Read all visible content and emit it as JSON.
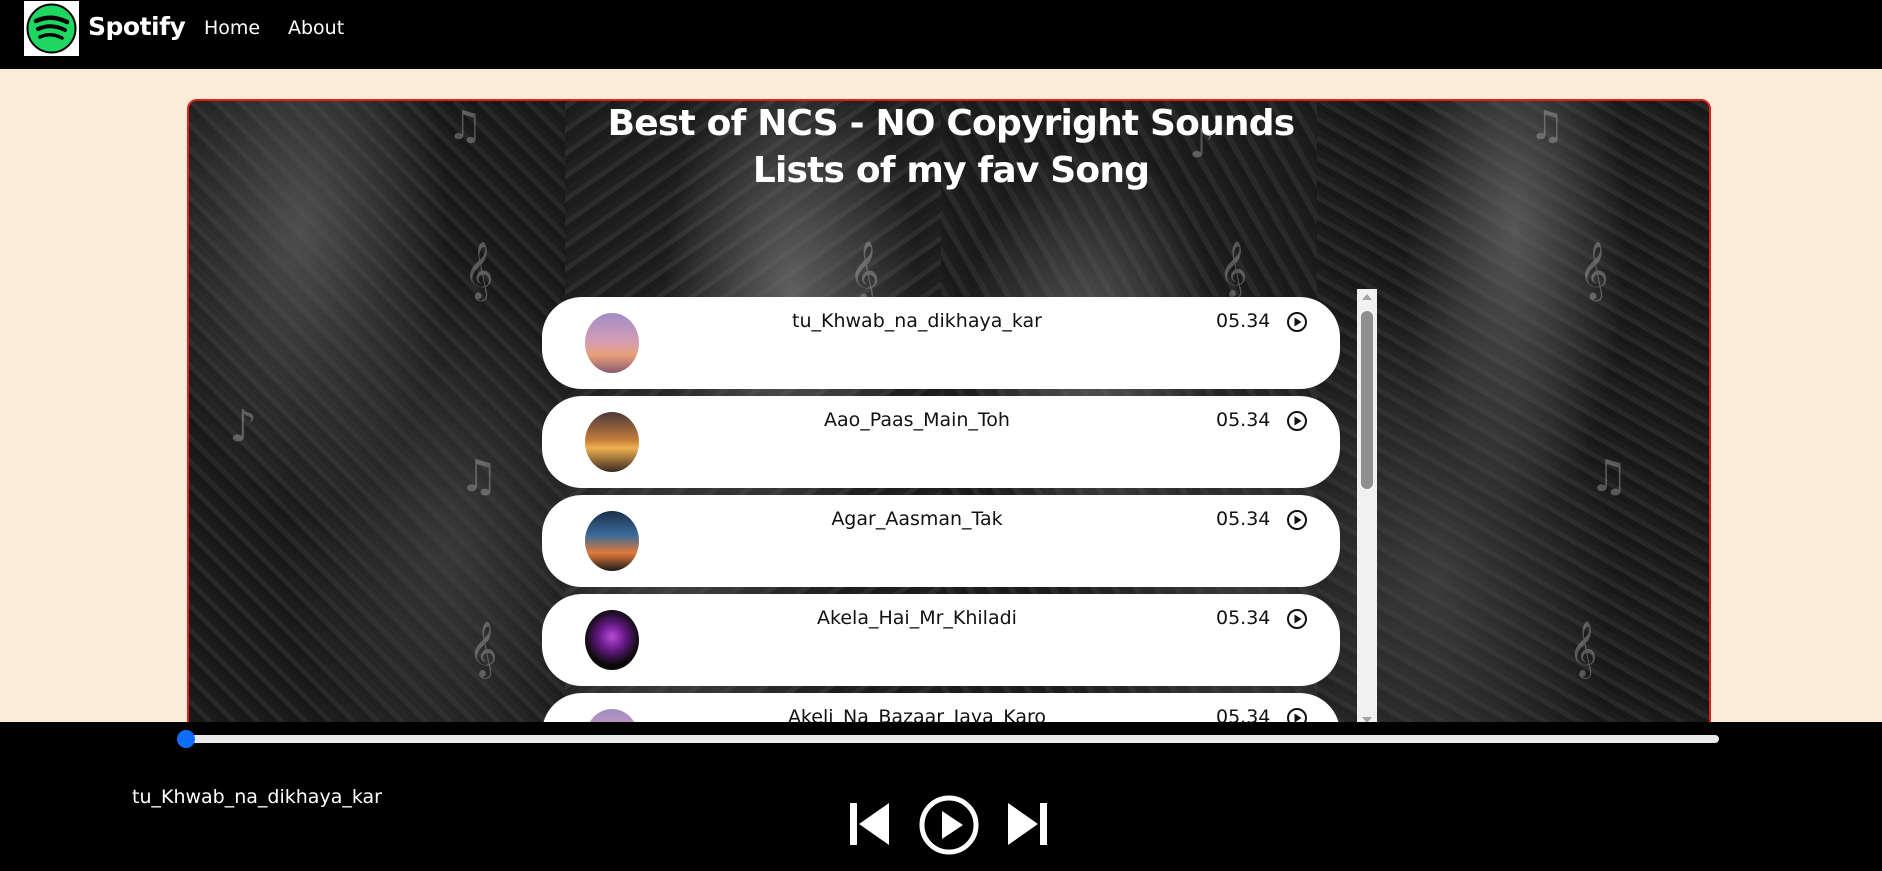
{
  "navbar": {
    "logo_icon": "spotify-logo-icon",
    "brand": "Spotify",
    "links": [
      {
        "label": "Home"
      },
      {
        "label": "About"
      }
    ]
  },
  "main": {
    "title_line1": "Best of NCS - NO Copyright Sounds",
    "title_line2": "Lists of my fav Song",
    "songs": [
      {
        "name": "tu_Khwab_na_dikhaya_kar",
        "time": "05.34",
        "play_icon": "play-circle-icon"
      },
      {
        "name": "Aao_Paas_Main_Toh",
        "time": "05.34",
        "play_icon": "play-circle-icon"
      },
      {
        "name": "Agar_Aasman_Tak",
        "time": "05.34",
        "play_icon": "play-circle-icon"
      },
      {
        "name": "Akela_Hai_Mr_Khiladi",
        "time": "05.34",
        "play_icon": "play-circle-icon"
      },
      {
        "name": "Akeli_Na_Bazaar_Jaya_Karo",
        "time": "05.34",
        "play_icon": "play-circle-icon"
      }
    ]
  },
  "player": {
    "progress_fraction": 0,
    "now_playing": "tu_Khwab_na_dikhaya_kar",
    "controls": [
      "skip-back-icon",
      "play-circle-icon",
      "skip-forward-icon"
    ]
  },
  "colors": {
    "brand_green": "#1ed760",
    "accent_blue": "#0d6efd",
    "panel_border": "#e21f1f",
    "page_bg": "#fbecd7"
  }
}
